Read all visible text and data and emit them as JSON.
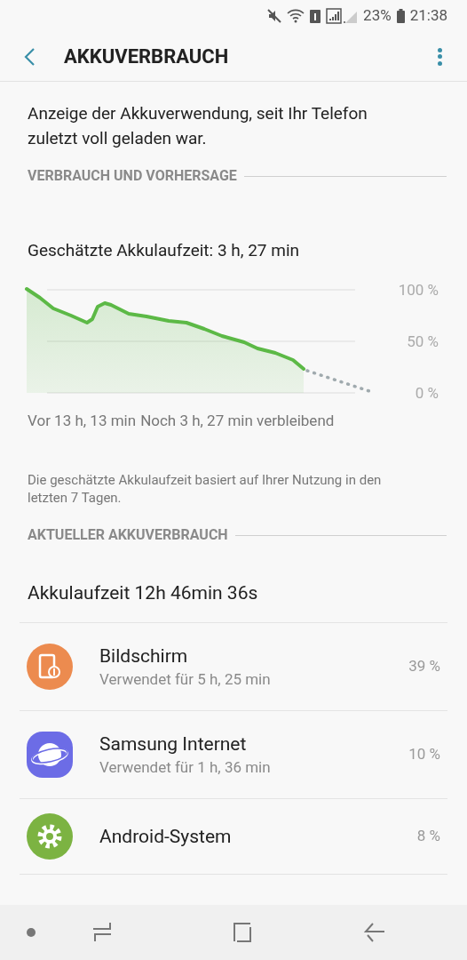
{
  "status_bar": {
    "battery": "23%",
    "time": "21:38"
  },
  "header": {
    "title": "AKKUVERBRAUCH"
  },
  "intro": "Anzeige der Akkuverwendung, seit Ihr Telefon zuletzt voll geladen war.",
  "section_forecast": {
    "title": "VERBRAUCH UND VORHERSAGE",
    "estimate": "Geschätzte Akkulaufzeit: 3 h, 27 min",
    "graph_axis_labels": [
      "100 %",
      "50 %",
      "0 %"
    ],
    "start_label": "Vor 13 h, 13 min",
    "end_label": "Noch 3 h, 27 min verbleibend",
    "note": "Die geschätzte Akkulaufzeit basiert auf Ihrer Nutzung in den letzten 7 Tagen."
  },
  "section_current": {
    "title": "AKTUELLER AKKUVERBRAUCH",
    "total": "Akkulaufzeit 12h 46min 36s",
    "items": [
      {
        "kind": "display",
        "name": "Bildschirm",
        "detail": "Verwendet für 5 h, 25 min",
        "percent": "39 %"
      },
      {
        "kind": "browser",
        "name": "Samsung Internet",
        "detail": "Verwendet für 1 h, 36 min",
        "percent": "10 %"
      },
      {
        "kind": "system",
        "name": "Android-System",
        "percent": "8 %"
      }
    ]
  }
}
